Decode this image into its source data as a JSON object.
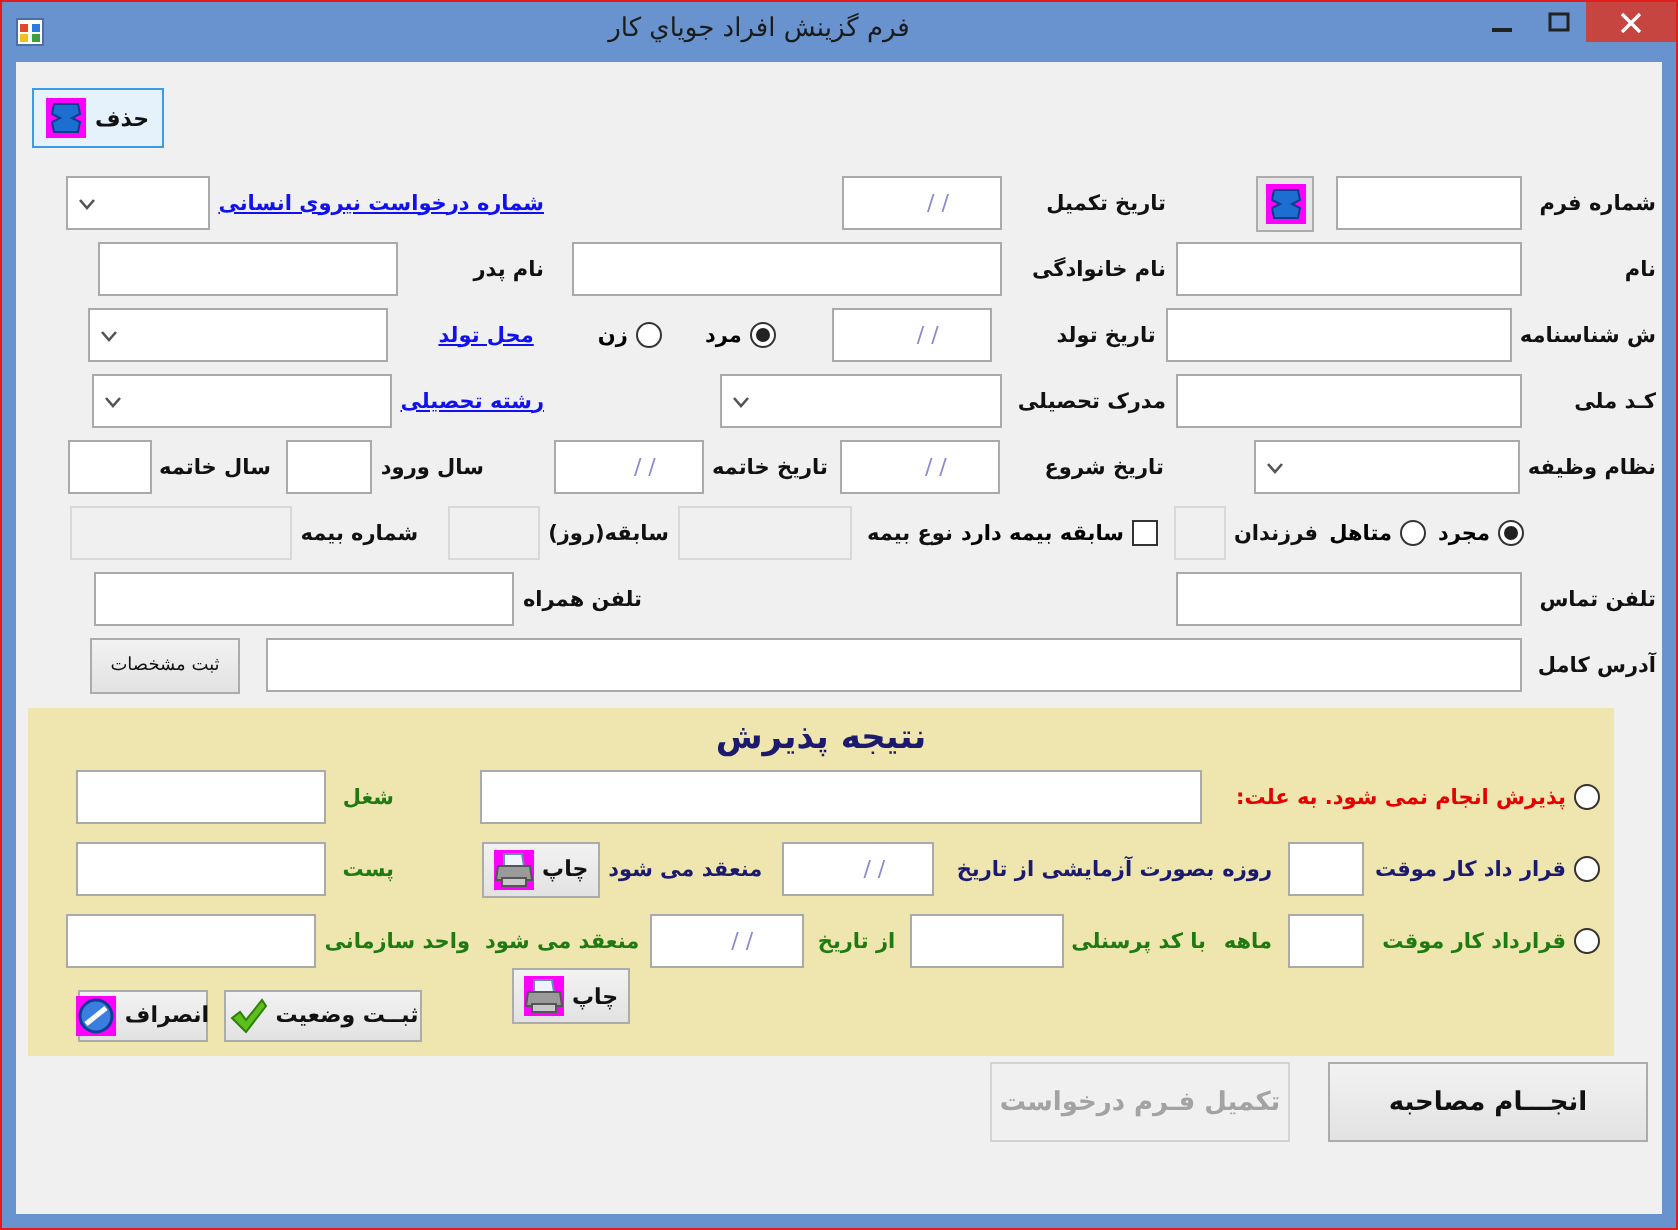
{
  "window": {
    "title": "فرم گزينش افراد جوياي كار"
  },
  "toolbar": [
    {
      "kind": "delete_button",
      "label": "حذف"
    }
  ],
  "form_rows": [
    [
      {
        "kind": "label",
        "text": "شماره فرم"
      },
      {
        "kind": "text_input"
      },
      {
        "kind": "icon_button"
      },
      {
        "kind": "label",
        "text": "تاريخ تکميل"
      },
      {
        "kind": "date_input",
        "value": "/ /"
      },
      {
        "kind": "link",
        "text": "شماره درخواست نیروی انسانی"
      },
      {
        "kind": "combo"
      }
    ],
    [
      {
        "kind": "label",
        "text": "نام"
      },
      {
        "kind": "text_input"
      },
      {
        "kind": "label",
        "text": "نام خانوادگی"
      },
      {
        "kind": "text_input"
      },
      {
        "kind": "label",
        "text": "نام پدر"
      },
      {
        "kind": "text_input"
      }
    ],
    [
      {
        "kind": "label",
        "text": "ش شناسنامه"
      },
      {
        "kind": "text_input"
      },
      {
        "kind": "label",
        "text": "تاريخ تولد"
      },
      {
        "kind": "date_input",
        "value": "/ /"
      },
      {
        "kind": "radio",
        "label": "مرد",
        "selected": true
      },
      {
        "kind": "radio",
        "label": "زن",
        "selected": false
      },
      {
        "kind": "link",
        "text": "محل تولد"
      },
      {
        "kind": "combo"
      }
    ],
    [
      {
        "kind": "label",
        "text": "کـد ملی"
      },
      {
        "kind": "text_input"
      },
      {
        "kind": "label",
        "text": "مدرک تحصيلی"
      },
      {
        "kind": "combo"
      },
      {
        "kind": "link",
        "text": "رشته تحصیلی"
      },
      {
        "kind": "combo"
      }
    ],
    [
      {
        "kind": "label",
        "text": "نظام وظيفه"
      },
      {
        "kind": "combo"
      },
      {
        "kind": "label",
        "text": "تاريخ شروع"
      },
      {
        "kind": "date_input",
        "value": "/ /"
      },
      {
        "kind": "label",
        "text": "تاريخ خاتمه"
      },
      {
        "kind": "date_input",
        "value": "/ /"
      },
      {
        "kind": "label",
        "text": "سال ورود"
      },
      {
        "kind": "text_input"
      },
      {
        "kind": "label",
        "text": "سال خاتمه"
      },
      {
        "kind": "text_input"
      }
    ],
    [
      {
        "kind": "radio",
        "label": "مجرد",
        "selected": true
      },
      {
        "kind": "radio",
        "label": "متاهل",
        "selected": false
      },
      {
        "kind": "label",
        "text": "فرزندان"
      },
      {
        "kind": "text_input",
        "disabled": true
      },
      {
        "kind": "checkbox",
        "label": "سابقه بیمه دارد",
        "checked": false
      },
      {
        "kind": "label",
        "text": "نوع بیمه"
      },
      {
        "kind": "text_input",
        "disabled": true
      },
      {
        "kind": "label",
        "text": "سابقه(روز)"
      },
      {
        "kind": "text_input",
        "disabled": true
      },
      {
        "kind": "label",
        "text": "شماره بیمه"
      },
      {
        "kind": "text_input",
        "disabled": true
      }
    ],
    [
      {
        "kind": "label",
        "text": "تلفن تماس"
      },
      {
        "kind": "text_input"
      },
      {
        "kind": "label",
        "text": "تلفن همراه"
      },
      {
        "kind": "text_input"
      }
    ],
    [
      {
        "kind": "label",
        "text": "آدرس کامل"
      },
      {
        "kind": "text_input"
      },
      {
        "kind": "small_button",
        "label": "ثبت مشخصات"
      }
    ]
  ],
  "result_panel": {
    "title": "نتیجه پذیرش",
    "options": [
      [
        {
          "kind": "radio",
          "label": "پذیرش انجام نمی شود.   به علت:",
          "selected": false,
          "color": "#e60000"
        },
        {
          "kind": "text_input"
        }
      ],
      [
        {
          "kind": "radio",
          "label": "قرار داد کار موقت",
          "selected": false,
          "color": "#1c1a6e"
        },
        {
          "kind": "text_input"
        },
        {
          "kind": "label",
          "text": "روزه",
          "color": "#1c1a6e"
        },
        {
          "kind": "label",
          "text": "بصورت آزمایشی از تاریخ",
          "color": "#1c1a6e"
        },
        {
          "kind": "date_input",
          "value": "/ /"
        },
        {
          "kind": "label",
          "text": "منعقد می شود",
          "color": "#1c1a6e"
        },
        {
          "kind": "print_button",
          "label": "چاپ"
        }
      ],
      [
        {
          "kind": "radio",
          "label": "قرارداد کار موقت",
          "selected": false,
          "color": "#1f7a12"
        },
        {
          "kind": "text_input"
        },
        {
          "kind": "label",
          "text": "ماهه",
          "color": "#1f7a12"
        },
        {
          "kind": "label",
          "text": "با کد پرسنلی",
          "color": "#1f7a12"
        },
        {
          "kind": "text_input"
        },
        {
          "kind": "label",
          "text": "از تاریخ",
          "color": "#1f7a12"
        },
        {
          "kind": "date_input",
          "value": "/ /"
        },
        {
          "kind": "label",
          "text": "منعقد می شود",
          "color": "#1f7a12"
        }
      ],
      [
        {
          "kind": "print_button",
          "label": "چاپ"
        }
      ]
    ],
    "position_fields": [
      [
        {
          "kind": "label",
          "text": "شغل",
          "color": "#1f7a12"
        },
        {
          "kind": "text_input"
        }
      ],
      [
        {
          "kind": "label",
          "text": "پست",
          "color": "#1f7a12"
        },
        {
          "kind": "text_input"
        }
      ],
      [
        {
          "kind": "label",
          "text": "واحد سازمانی",
          "color": "#1f7a12"
        },
        {
          "kind": "text_input"
        }
      ]
    ],
    "actions": [
      {
        "kind": "confirm_button",
        "label": "ثبــت وضعیت"
      },
      {
        "kind": "cancel_button",
        "label": "انصراف"
      }
    ]
  },
  "footer_buttons": [
    {
      "label": "انجـــام مصاحبه",
      "disabled": false
    },
    {
      "label": "تکمیل فـرم درخواست",
      "disabled": true
    }
  ]
}
